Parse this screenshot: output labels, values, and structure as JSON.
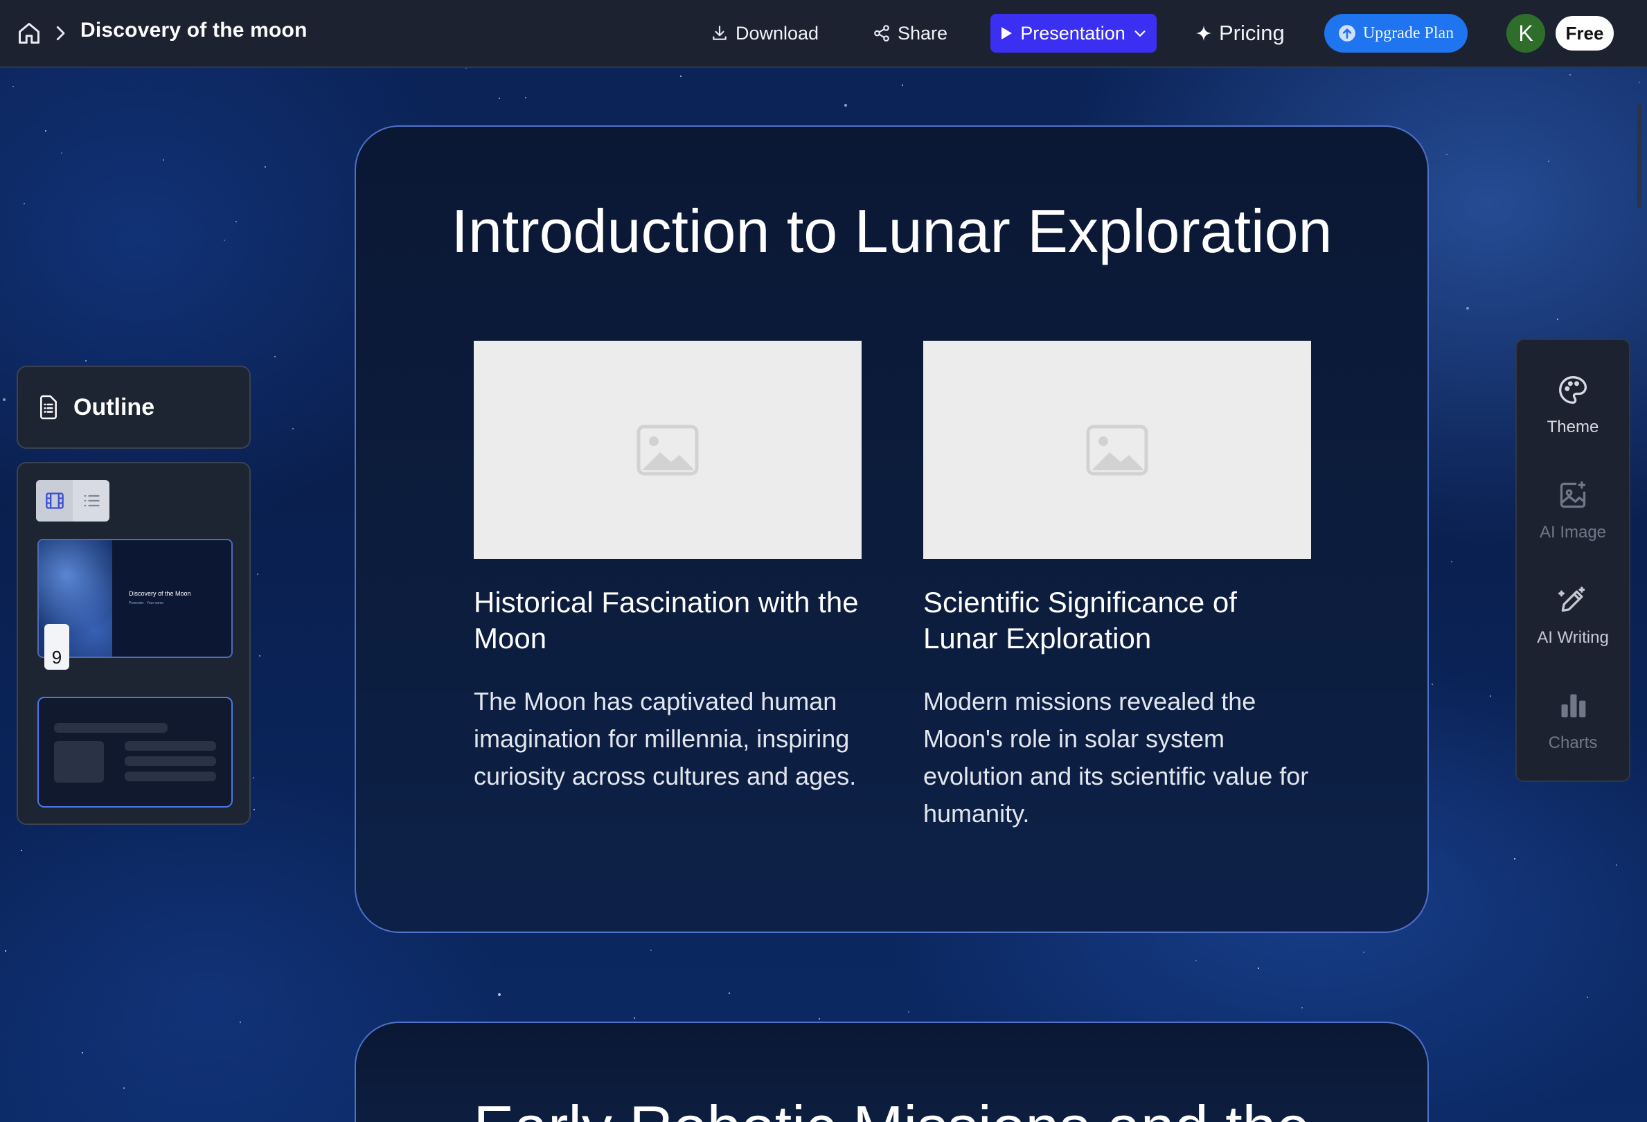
{
  "topbar": {
    "doc_title": "Discovery of the moon",
    "download_label": "Download",
    "share_label": "Share",
    "presentation_label": "Presentation",
    "pricing_label": "Pricing",
    "upgrade_label": "Upgrade Plan",
    "avatar_initial": "K",
    "plan_badge": "Free"
  },
  "sidebar": {
    "outline_label": "Outline",
    "thumbnail": {
      "title": "Discovery of the Moon",
      "subtitle": "Presenter · Your name",
      "slide_number": "9"
    }
  },
  "tools": [
    {
      "label": "Theme",
      "icon": "palette-icon"
    },
    {
      "label": "AI Image",
      "icon": "image-sparkle-icon"
    },
    {
      "label": "AI Writing",
      "icon": "pen-sparkle-icon"
    },
    {
      "label": "Charts",
      "icon": "bar-chart-icon"
    }
  ],
  "slides": [
    {
      "title": "Introduction to Lunar Exploration",
      "columns": [
        {
          "title": "Historical Fascination with the Moon",
          "body": "The Moon has captivated human imagination for millennia, inspiring curiosity across cultures and ages."
        },
        {
          "title": "Scientific Significance of Lunar Exploration",
          "body": "Modern missions revealed the Moon's role in solar system evolution and its scientific value for humanity."
        }
      ]
    },
    {
      "title": "Early Robotic Missions and the"
    }
  ],
  "colors": {
    "topbar_bg": "#1c2230",
    "presentation_button": "#3b30f2",
    "upgrade_button": "#1f74ef",
    "slide_border": "#4f71c9",
    "avatar_bg": "#2f6e2a"
  }
}
